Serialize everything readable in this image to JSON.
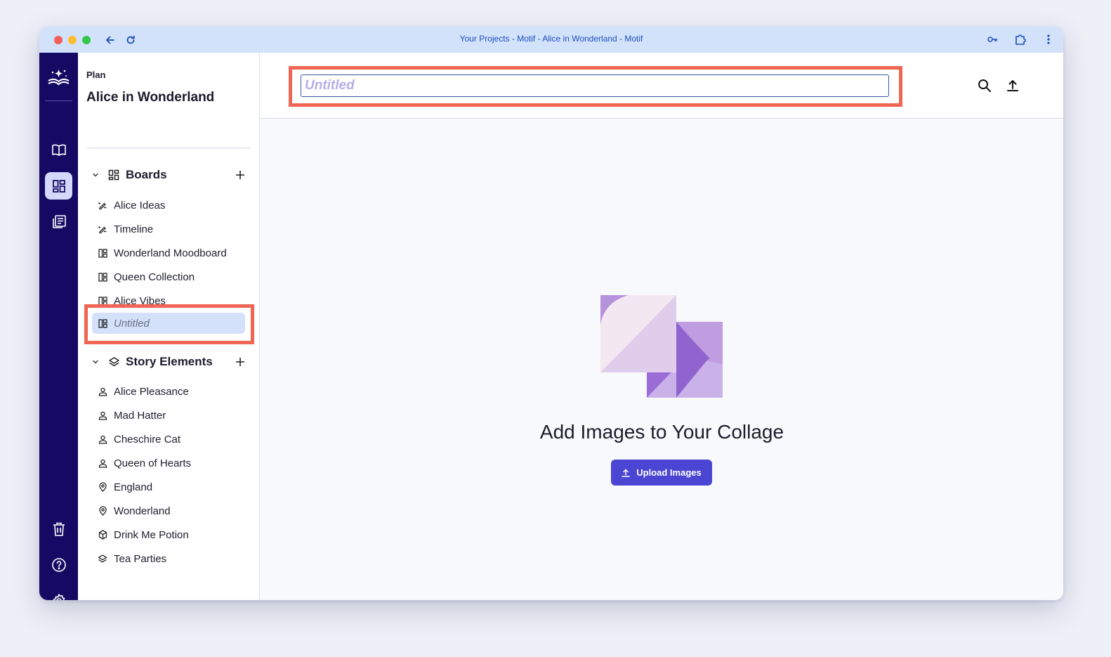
{
  "browser": {
    "window_title": "Your Projects - Motif - Alice in Wonderland - Motif"
  },
  "sidebar": {
    "section_label": "Plan",
    "project_title": "Alice in Wonderland",
    "boards": {
      "title": "Boards",
      "items": [
        {
          "label": "Alice Ideas",
          "icon": "sparkle-pencil-icon"
        },
        {
          "label": "Timeline",
          "icon": "sparkle-pencil-icon"
        },
        {
          "label": "Wonderland Moodboard",
          "icon": "board-icon"
        },
        {
          "label": "Queen Collection",
          "icon": "board-icon"
        },
        {
          "label": "Alice Vibes",
          "icon": "board-icon"
        },
        {
          "label": "Untitled",
          "icon": "board-icon",
          "selected": true
        }
      ]
    },
    "story_elements": {
      "title": "Story Elements",
      "items": [
        {
          "label": "Alice Pleasance",
          "icon": "person-icon"
        },
        {
          "label": "Mad Hatter",
          "icon": "person-icon"
        },
        {
          "label": "Cheschire Cat",
          "icon": "person-icon"
        },
        {
          "label": "Queen of Hearts",
          "icon": "person-icon"
        },
        {
          "label": "England",
          "icon": "location-pin-icon"
        },
        {
          "label": "Wonderland",
          "icon": "location-pin-icon"
        },
        {
          "label": "Drink Me Potion",
          "icon": "cube-icon"
        },
        {
          "label": "Tea Parties",
          "icon": "layers-icon"
        }
      ]
    }
  },
  "main": {
    "title_input": {
      "value": "",
      "placeholder": "Untitled"
    },
    "empty_state": {
      "title": "Add Images to Your Collage",
      "button_label": "Upload Images"
    }
  },
  "colors": {
    "rail": "#140a63",
    "accent": "#4b45d3",
    "highlight": "#ef6655",
    "selected_item": "#d3e1fb"
  }
}
